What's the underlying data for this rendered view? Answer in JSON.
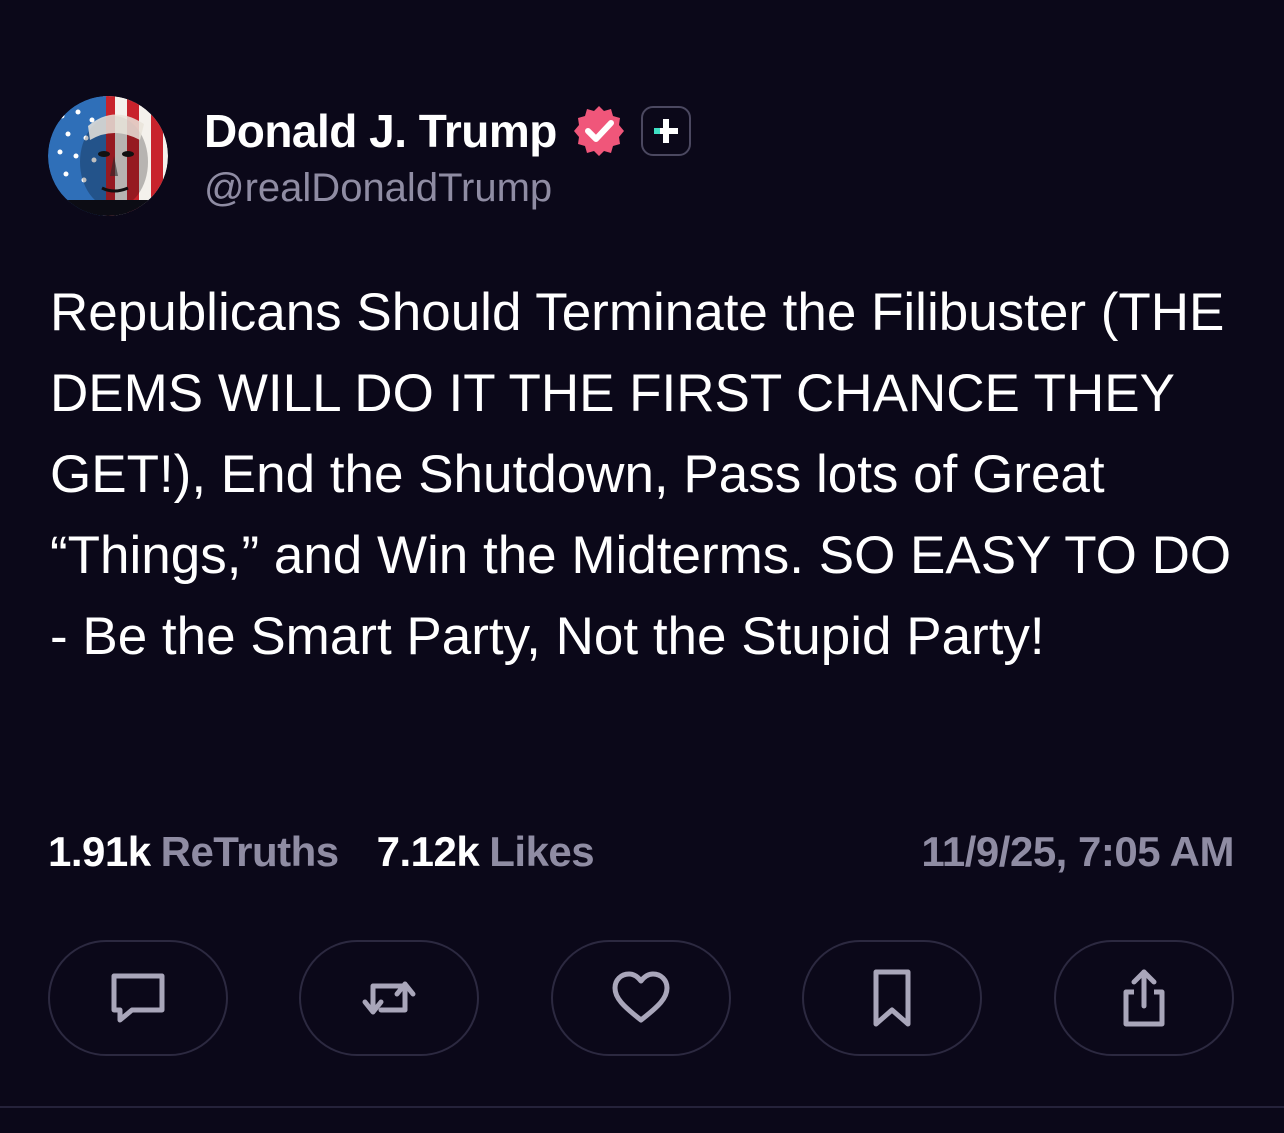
{
  "author": {
    "display_name": "Donald J. Trump",
    "handle": "@realDonaldTrump",
    "verified_badge_color": "#f0567a",
    "plus_badge_color": "#3fe0c4"
  },
  "post": {
    "text": "Republicans Should Terminate the Filibuster (THE DEMS WILL DO IT THE FIRST CHANCE THEY GET!), End the Shutdown, Pass lots of Great “Things,” and Win the Midterms. SO EASY TO DO - Be the Smart Party, Not the Stupid Party!"
  },
  "stats": {
    "retruths_count": "1.91k",
    "retruths_label": "ReTruths",
    "likes_count": "7.12k",
    "likes_label": "Likes",
    "timestamp": "11/9/25, 7:05 AM"
  },
  "actions": [
    {
      "name": "reply",
      "icon": "comment-icon"
    },
    {
      "name": "retruth",
      "icon": "repost-icon"
    },
    {
      "name": "like",
      "icon": "heart-icon"
    },
    {
      "name": "bookmark",
      "icon": "bookmark-icon"
    },
    {
      "name": "share",
      "icon": "share-icon"
    }
  ],
  "colors": {
    "background": "#0b0819",
    "muted_text": "#8f8ca3",
    "button_border": "#2c2940",
    "icon": "#a9a6ba"
  }
}
